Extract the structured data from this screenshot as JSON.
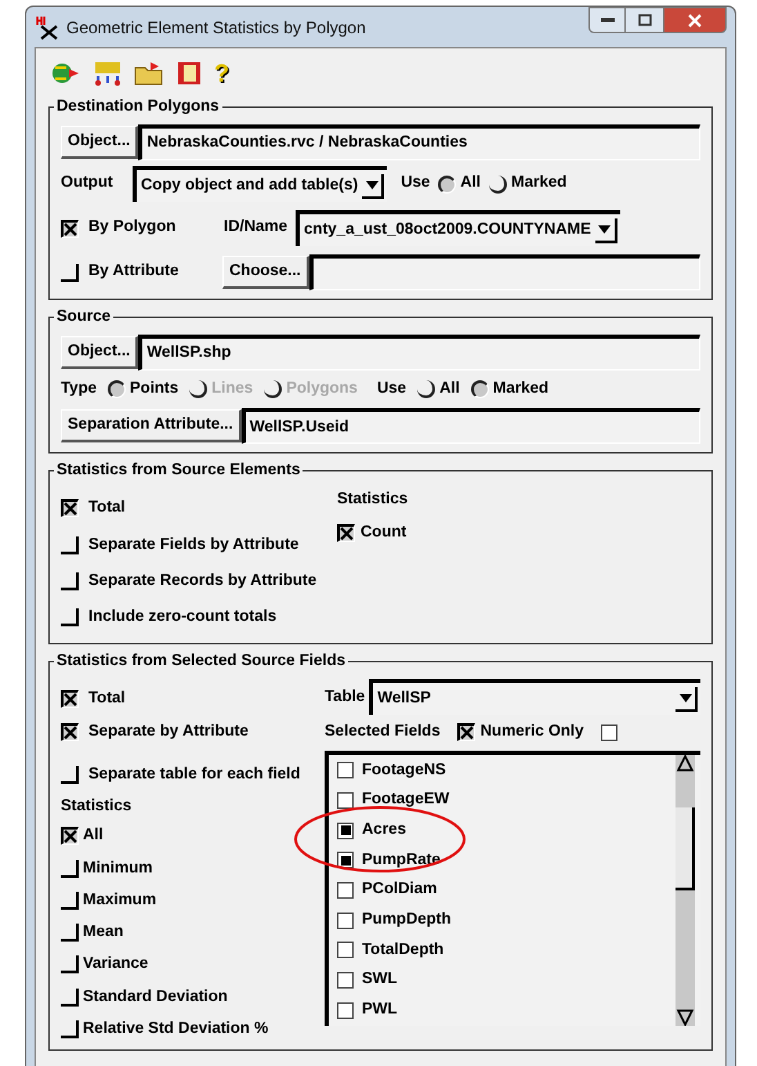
{
  "window": {
    "title": "Geometric Element Statistics by Polygon"
  },
  "toolbar": {
    "help_icon": "?"
  },
  "destination": {
    "title": "Destination Polygons",
    "object_button": "Object...",
    "object_value": "NebraskaCounties.rvc / NebraskaCounties",
    "output_label": "Output",
    "output_value": "Copy object and add table(s)",
    "use_label": "Use",
    "use_options": [
      {
        "label": "All",
        "selected": true
      },
      {
        "label": "Marked",
        "selected": false
      }
    ],
    "by_polygon": {
      "label": "By Polygon",
      "checked": true
    },
    "id_label": "ID/Name",
    "id_value": "cnty_a_ust_08oct2009.COUNTYNAME",
    "by_attribute": {
      "label": "By Attribute",
      "checked": false
    },
    "choose_button": "Choose..."
  },
  "source": {
    "title": "Source",
    "object_button": "Object...",
    "object_value": "WellSP.shp",
    "type_label": "Type",
    "types": [
      {
        "label": "Points",
        "selected": true,
        "disabled": false
      },
      {
        "label": "Lines",
        "selected": false,
        "disabled": true
      },
      {
        "label": "Polygons",
        "selected": false,
        "disabled": true
      }
    ],
    "use_label": "Use",
    "use_options": [
      {
        "label": "All",
        "selected": false
      },
      {
        "label": "Marked",
        "selected": true
      }
    ],
    "separation_button": "Separation Attribute...",
    "separation_value": "WellSP.Useid"
  },
  "elements": {
    "title": "Statistics from Source Elements",
    "options": [
      {
        "label": "Total",
        "checked": true
      },
      {
        "label": "Separate Fields by Attribute",
        "checked": false
      },
      {
        "label": "Separate Records by Attribute",
        "checked": false
      },
      {
        "label": "Include zero-count totals",
        "checked": false
      }
    ],
    "statistics_label": "Statistics",
    "statistics": [
      {
        "label": "Count",
        "checked": true
      }
    ]
  },
  "fields": {
    "title": "Statistics from Selected Source Fields",
    "options": [
      {
        "label": "Total",
        "checked": true
      },
      {
        "label": "Separate by Attribute",
        "checked": true
      },
      {
        "label": "Separate table for each field",
        "checked": false
      }
    ],
    "statistics_label": "Statistics",
    "statistics": [
      {
        "label": "All",
        "checked": true
      },
      {
        "label": "Minimum",
        "checked": false
      },
      {
        "label": "Maximum",
        "checked": false
      },
      {
        "label": "Mean",
        "checked": false
      },
      {
        "label": "Variance",
        "checked": false
      },
      {
        "label": "Standard Deviation",
        "checked": false
      },
      {
        "label": "Relative Std Deviation %",
        "checked": false
      }
    ],
    "table_label": "Table",
    "table_value": "WellSP",
    "selected_fields_label": "Selected Fields",
    "numeric_only": {
      "label": "Numeric Only",
      "checked": true
    },
    "all_fields_checked": false,
    "field_list": [
      {
        "label": "FootageNS",
        "checked": false
      },
      {
        "label": "FootageEW",
        "checked": false
      },
      {
        "label": "Acres",
        "checked": true
      },
      {
        "label": "PumpRate",
        "checked": true
      },
      {
        "label": "PColDiam",
        "checked": false
      },
      {
        "label": "PumpDepth",
        "checked": false
      },
      {
        "label": "TotalDepth",
        "checked": false
      },
      {
        "label": "SWL",
        "checked": false
      },
      {
        "label": "PWL",
        "checked": false
      }
    ]
  }
}
